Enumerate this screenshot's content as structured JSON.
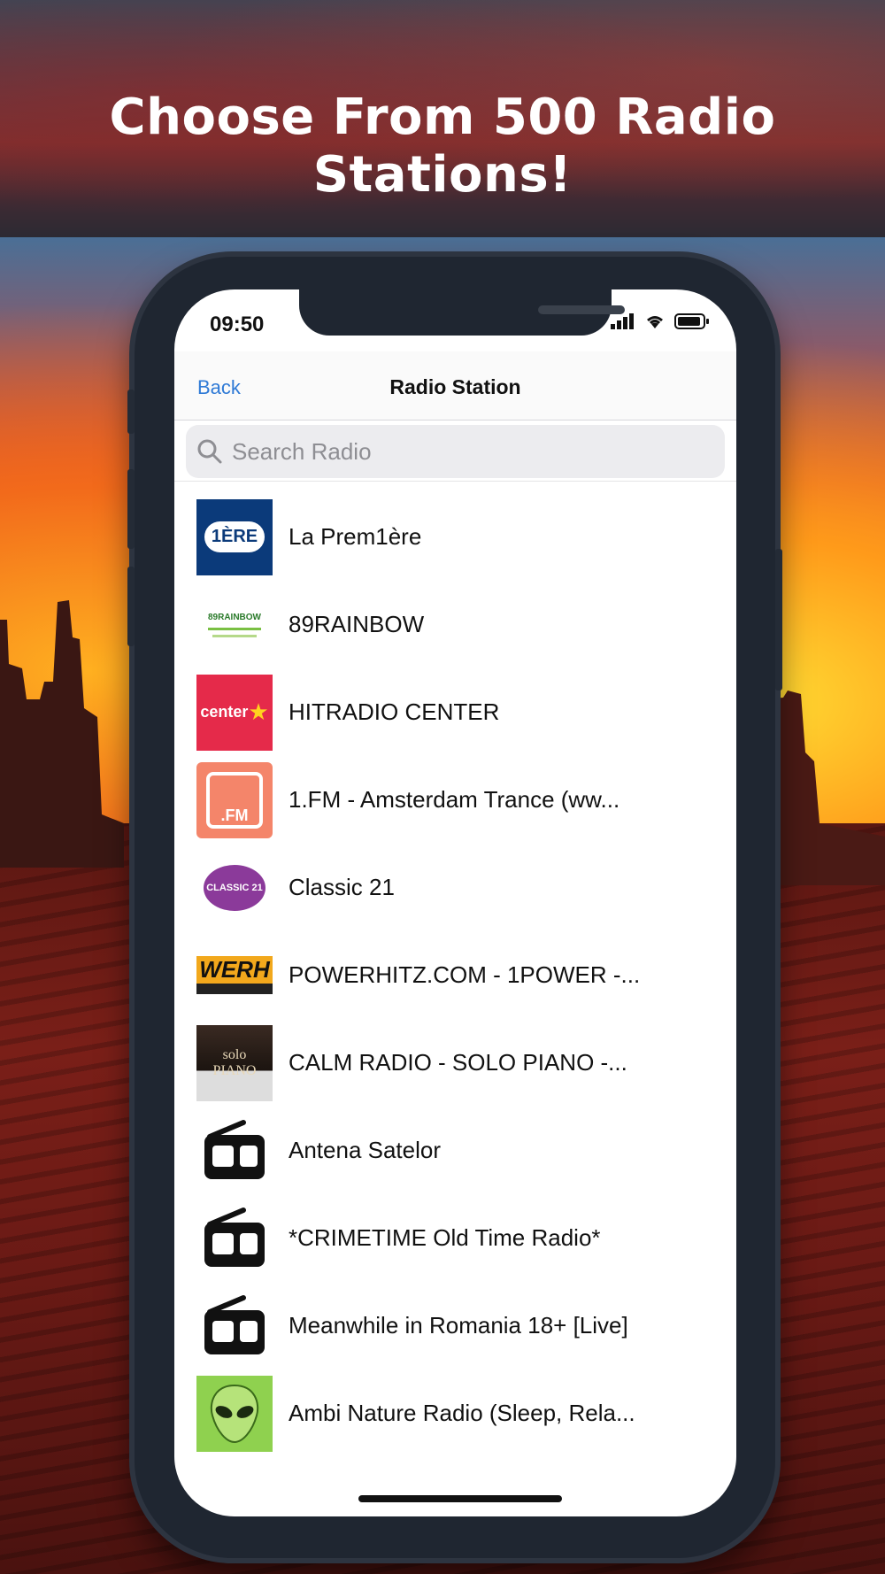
{
  "headline": "Choose From 500 Radio Stations!",
  "status_bar": {
    "time": "09:50"
  },
  "navbar": {
    "back_label": "Back",
    "title": "Radio Station"
  },
  "search": {
    "placeholder": "Search Radio"
  },
  "stations": [
    {
      "name": "La Prem1ère",
      "logo": "la-premiere-logo",
      "logo_text": "1ÈRE"
    },
    {
      "name": "89RAINBOW",
      "logo": "89rainbow-logo",
      "logo_text": "89RAINBOW"
    },
    {
      "name": "HITRADIO CENTER",
      "logo": "hitradio-center-logo",
      "logo_text": "center"
    },
    {
      "name": "1.FM - Amsterdam Trance (ww...",
      "logo": "1fm-logo",
      "logo_text": ".FM"
    },
    {
      "name": "Classic 21",
      "logo": "classic21-logo",
      "logo_text": "CLASSIC 21"
    },
    {
      "name": "POWERHITZ.COM - 1POWER -...",
      "logo": "powerhitz-logo",
      "logo_text": "WERH"
    },
    {
      "name": "CALM RADIO - SOLO PIANO -...",
      "logo": "solo-piano-logo",
      "logo_text": "solo PIANO"
    },
    {
      "name": "Antena Satelor",
      "logo": "radio-icon"
    },
    {
      "name": "*CRIMETIME Old Time Radio*",
      "logo": "radio-icon"
    },
    {
      "name": "Meanwhile in Romania 18+ [Live]",
      "logo": "radio-icon"
    },
    {
      "name": "Ambi Nature Radio (Sleep, Rela...",
      "logo": "alien-logo"
    }
  ],
  "colors": {
    "accent": "#2f7ad6",
    "phone_frame": "#1f2631"
  }
}
